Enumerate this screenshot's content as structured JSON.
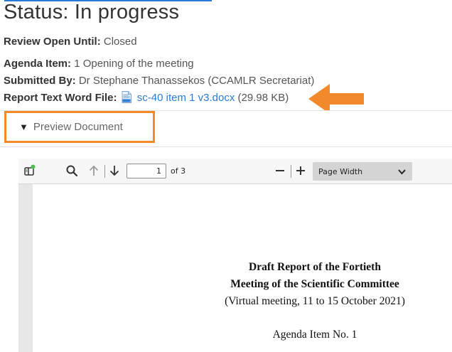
{
  "status": {
    "title": "Status: In progress"
  },
  "review": {
    "label": "Review Open Until:",
    "value": "Closed"
  },
  "agenda": {
    "label": "Agenda Item:",
    "value": "1 Opening of the meeting"
  },
  "submitted": {
    "label": "Submitted By:",
    "value": "Dr Stephane Thanassekos (CCAMLR Secretariat)"
  },
  "report": {
    "label": "Report Text Word File:",
    "file_name": "sc-40 item 1 v3.docx",
    "file_size": "(29.98 KB)",
    "icon": "docx-file-icon"
  },
  "preview": {
    "toggle_icon": "▼",
    "label": "Preview Document"
  },
  "viewer": {
    "current_page": "1",
    "page_count": "of 3",
    "zoom_label": "Page Width"
  },
  "document": {
    "line1": "Draft Report of the Fortieth",
    "line2": "Meeting of the Scientific Committee",
    "line3": "(Virtual meeting, 11 to 15 October 2021)",
    "line4": "Agenda Item No. 1"
  },
  "colors": {
    "accent": "#2a7bd6",
    "highlight": "#f28a2b"
  }
}
